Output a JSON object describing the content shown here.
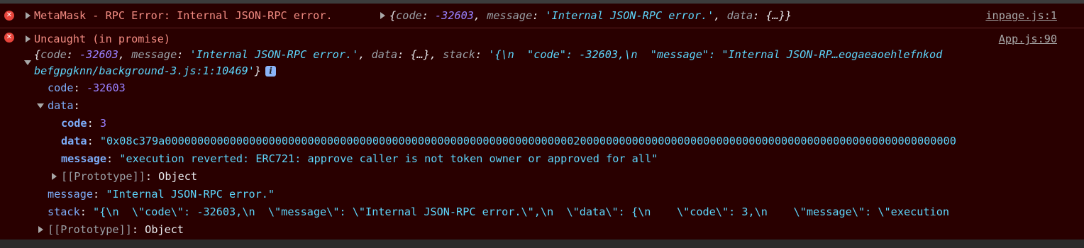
{
  "colors": {
    "background": "#290000",
    "error_text": "#f28b82",
    "key": "#7cacf8",
    "number": "#9980ff",
    "string": "#5cd5fb",
    "icon_error": "#e8453c"
  },
  "msg1": {
    "icon": "error-circle-icon",
    "text": "MetaMask - RPC Error: Internal JSON-RPC error.",
    "obj": {
      "open": "{",
      "k_code": "code",
      "v_code": "-32603",
      "k_message": "message",
      "v_message": "'Internal JSON-RPC error.'",
      "k_data": "data",
      "v_data": "{…}",
      "close": "}"
    },
    "source": "inpage.js:1"
  },
  "msg2": {
    "icon": "error-circle-icon",
    "text": "Uncaught (in promise)",
    "source": "App.js:90",
    "summary": {
      "open": "{",
      "k_code": "code",
      "v_code": "-32603",
      "k_message": "message",
      "v_message": "'Internal JSON-RPC error.'",
      "k_data": "data",
      "v_data": "{…}",
      "k_stack": "stack",
      "v_stack_1": "'{\\n  \"code\": -32603,\\n  \"message\": \"Internal JSON-RP…eogaeaoehlefnkod",
      "v_stack_2": "befgpgknn/background-3.js:1:10469'",
      "close": "}",
      "info": "i"
    },
    "props": {
      "code_key": "code",
      "code_val": "-32603",
      "data_key": "data",
      "data": {
        "code_key": "code",
        "code_val": "3",
        "data_key": "data",
        "data_val": "\"0x08c379a00000000000000000000000000000000000000000000000000000000000000020000000000000000000000000000000000000000000000000000000000",
        "message_key": "message",
        "message_val": "\"execution reverted: ERC721: approve caller is not token owner or approved for all\"",
        "proto_key": "[[Prototype]]",
        "proto_val": "Object"
      },
      "message_key": "message",
      "message_val": "\"Internal JSON-RPC error.\"",
      "stack_key": "stack",
      "stack_val": "\"{\\n  \\\"code\\\": -32603,\\n  \\\"message\\\": \\\"Internal JSON-RPC error.\\\",\\n  \\\"data\\\": {\\n    \\\"code\\\": 3,\\n    \\\"message\\\": \\\"execution",
      "proto_key": "[[Prototype]]",
      "proto_val": "Object"
    }
  }
}
